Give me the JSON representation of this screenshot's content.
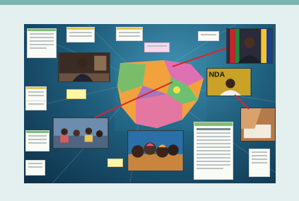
{
  "board": {
    "colors": {
      "page_background": "#e4efef",
      "header_bar": "#7bb5b0",
      "board_center": "#3f8fae",
      "board_edge": "#0d2f47",
      "connector": "#d8262b",
      "map_pink": "#e070b4",
      "map_orange": "#f2a23c",
      "map_green": "#6cc070",
      "sticky_yellow": "#fff6a8"
    },
    "icons": [
      "note-card",
      "photo",
      "map",
      "connector-line",
      "document"
    ],
    "photo_text": "NDA"
  }
}
